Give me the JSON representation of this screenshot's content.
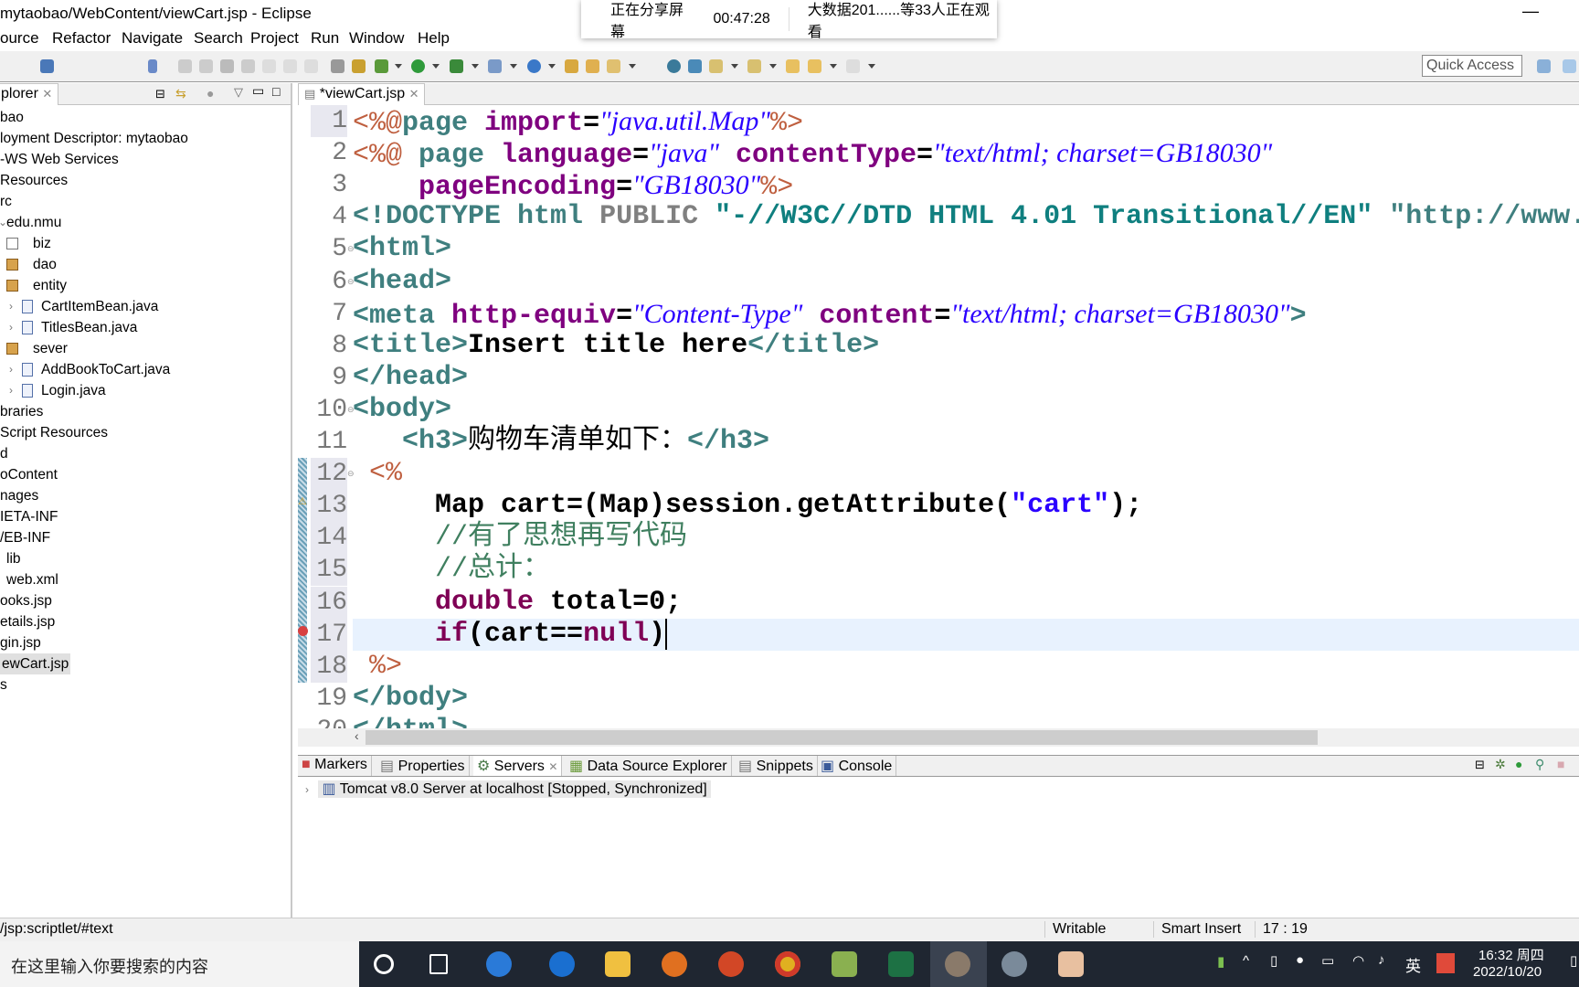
{
  "window": {
    "title": "mytaobao/WebContent/viewCart.jsp - Eclipse"
  },
  "share_popup": {
    "status": "正在分享屏幕",
    "elapsed": "00:47:28",
    "viewers": "大数据201......等33人正在观看"
  },
  "menu": [
    "ource",
    "Refactor",
    "Navigate",
    "Search",
    "Project",
    "Run",
    "Window",
    "Help"
  ],
  "toolbar": {
    "quick_access_placeholder": "Quick Access"
  },
  "explorer": {
    "tab_label": "plorer",
    "items": [
      {
        "label": "bao",
        "depth": 0,
        "icon": ""
      },
      {
        "label": "loyment Descriptor: mytaobao",
        "depth": 0,
        "icon": ""
      },
      {
        "label": "-WS Web Services",
        "depth": 0,
        "icon": ""
      },
      {
        "label": " Resources",
        "depth": 0,
        "icon": ""
      },
      {
        "label": "rc",
        "depth": 0,
        "icon": ""
      },
      {
        "label": "edu.nmu",
        "depth": 1,
        "icon": "expanded-arrow"
      },
      {
        "label": "biz",
        "depth": 2,
        "icon": "package-empty-icon"
      },
      {
        "label": "dao",
        "depth": 2,
        "icon": "package-warning-icon"
      },
      {
        "label": "entity",
        "depth": 2,
        "icon": "package-warning-icon"
      },
      {
        "label": "CartItemBean.java",
        "depth": 3,
        "icon": "java-file-warning-icon"
      },
      {
        "label": "TitlesBean.java",
        "depth": 3,
        "icon": "java-file-warning-icon"
      },
      {
        "label": "sever",
        "depth": 2,
        "icon": "package-warning-icon"
      },
      {
        "label": "AddBookToCart.java",
        "depth": 3,
        "icon": "java-file-warning-icon"
      },
      {
        "label": "Login.java",
        "depth": 3,
        "icon": "java-file-icon"
      },
      {
        "label": "braries",
        "depth": 0,
        "icon": ""
      },
      {
        "label": "Script Resources",
        "depth": 0,
        "icon": ""
      },
      {
        "label": "d",
        "depth": 0,
        "icon": ""
      },
      {
        "label": "oContent",
        "depth": 0,
        "icon": ""
      },
      {
        "label": "nages",
        "depth": 0,
        "icon": ""
      },
      {
        "label": "IETA-INF",
        "depth": 0,
        "icon": ""
      },
      {
        "label": "/EB-INF",
        "depth": 0,
        "icon": ""
      },
      {
        "label": "lib",
        "depth": 1,
        "icon": ""
      },
      {
        "label": "web.xml",
        "depth": 1,
        "icon": ""
      },
      {
        "label": "ooks.jsp",
        "depth": 0,
        "icon": ""
      },
      {
        "label": "etails.jsp",
        "depth": 0,
        "icon": ""
      },
      {
        "label": "gin.jsp",
        "depth": 0,
        "icon": ""
      },
      {
        "label": "ewCart.jsp",
        "depth": 0,
        "icon": "",
        "selected": true
      },
      {
        "label": "s",
        "depth": 0,
        "icon": ""
      }
    ]
  },
  "editor": {
    "tab_label": "*viewCart.jsp",
    "cursor_line": 17,
    "lines": [
      [
        [
          "<%@",
          "d"
        ],
        [
          "page",
          "tag"
        ],
        [
          " ",
          "cn"
        ],
        [
          "import",
          "at"
        ],
        [
          "=",
          "t"
        ],
        [
          "\"java.util.Map\"",
          "s"
        ],
        [
          "%>",
          "d"
        ]
      ],
      [
        [
          "<%@",
          "d"
        ],
        [
          " page ",
          "tag"
        ],
        [
          "language",
          "at"
        ],
        [
          "=",
          "t"
        ],
        [
          "\"java\"",
          "s"
        ],
        [
          " ",
          "cn"
        ],
        [
          "contentType",
          "at"
        ],
        [
          "=",
          "t"
        ],
        [
          "\"text/html; charset=GB18030\"",
          "s"
        ]
      ],
      [
        [
          "    ",
          "cn"
        ],
        [
          "pageEncoding",
          "at"
        ],
        [
          "=",
          "t"
        ],
        [
          "\"GB18030\"",
          "s"
        ],
        [
          "%>",
          "d"
        ]
      ],
      [
        [
          "<!DOCTYPE",
          "tag"
        ],
        [
          " html ",
          "tag"
        ],
        [
          "PUBLIC",
          "gr"
        ],
        [
          " \"-//W3C//DTD HTML 4.01 Transitional//EN\" ",
          "ds"
        ],
        [
          "\"http://www.",
          "tag"
        ]
      ],
      [
        [
          "<html>",
          "tag"
        ]
      ],
      [
        [
          "<head>",
          "tag"
        ]
      ],
      [
        [
          "<meta ",
          "tag"
        ],
        [
          "http-equiv",
          "at"
        ],
        [
          "=",
          "t"
        ],
        [
          "\"Content-Type\"",
          "s"
        ],
        [
          " ",
          "cn"
        ],
        [
          "content",
          "at"
        ],
        [
          "=",
          "t"
        ],
        [
          "\"text/html; charset=GB18030\"",
          "s"
        ],
        [
          ">",
          "tag"
        ]
      ],
      [
        [
          "<title>",
          "tag"
        ],
        [
          "Insert title here",
          "t"
        ],
        [
          "</title>",
          "tag"
        ]
      ],
      [
        [
          "</head>",
          "tag"
        ]
      ],
      [
        [
          "<body>",
          "tag"
        ]
      ],
      [
        [
          "   <h3>",
          "tag"
        ],
        [
          "购物车清单如下：",
          "cn"
        ],
        [
          "</h3>",
          "tag"
        ]
      ],
      [
        [
          " <%",
          "d"
        ]
      ],
      [
        [
          "     Map cart=(Map)session.getAttribute(",
          "t"
        ],
        [
          "\"cart\"",
          "js"
        ],
        [
          ");",
          "t"
        ]
      ],
      [
        [
          "     //有了思想再写代码",
          "cm"
        ]
      ],
      [
        [
          "     //总计：",
          "cm"
        ]
      ],
      [
        [
          "     ",
          "cn"
        ],
        [
          "double",
          "kw"
        ],
        [
          " total=0;",
          "t"
        ]
      ],
      [
        [
          "     ",
          "cn"
        ],
        [
          "if",
          "kw"
        ],
        [
          "(cart==",
          "t"
        ],
        [
          "null",
          "kw"
        ],
        [
          ")",
          "t"
        ]
      ],
      [
        [
          " %>",
          "d"
        ]
      ],
      [
        [
          "</body>",
          "tag"
        ]
      ],
      [
        [
          "</html>",
          "tag"
        ]
      ]
    ]
  },
  "bottom_panel": {
    "tabs": [
      "Markers",
      "Properties",
      "Servers",
      "Data Source Explorer",
      "Snippets",
      "Console"
    ],
    "active_tab": "Servers",
    "server": "Tomcat v8.0 Server at localhost  [Stopped, Synchronized]"
  },
  "status": {
    "path": "/jsp:scriptlet/#text",
    "mode": "Writable",
    "insert": "Smart Insert",
    "position": "17 : 19"
  },
  "taskbar": {
    "search_placeholder": "在这里输入你要搜索的内容",
    "ime": "英",
    "time": "16:32 周四",
    "date": "2022/10/20"
  },
  "colors": {
    "accent": "#3f7f7f",
    "directive": "#bf5f3f",
    "attribute": "#7f007f",
    "string": "#2a00ff",
    "keyword": "#7f0055",
    "comment": "#3f7f5f"
  }
}
